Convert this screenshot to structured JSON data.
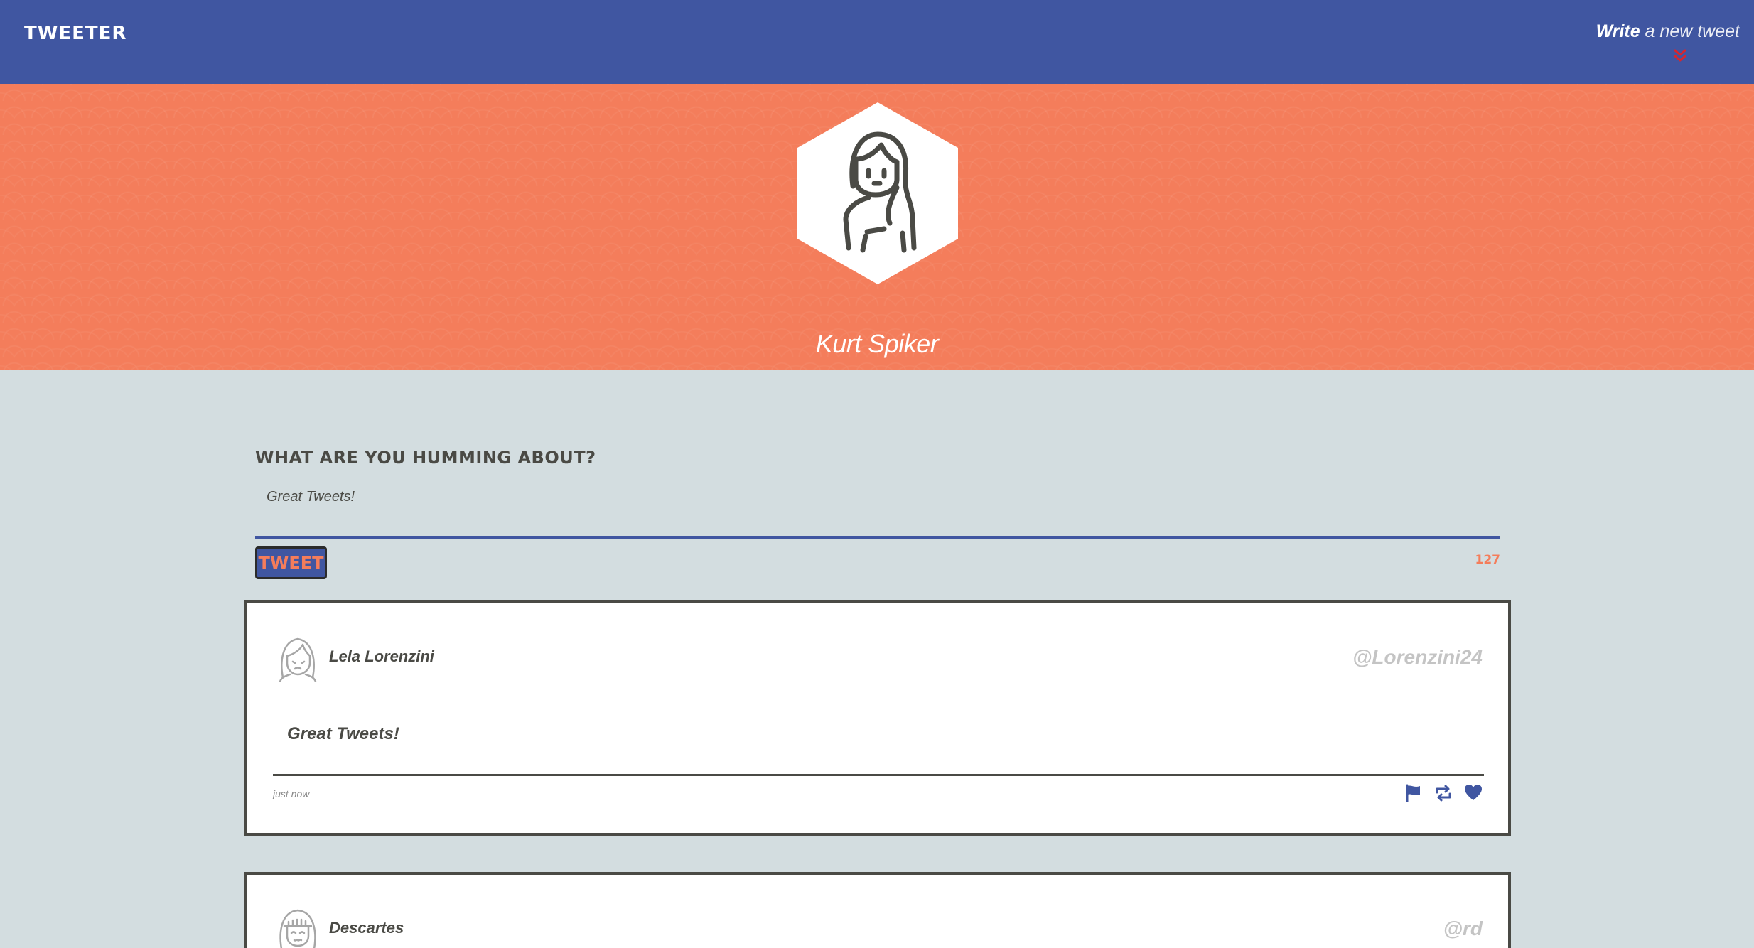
{
  "nav": {
    "brand": "TWEETER",
    "compose_toggle": {
      "strong": "Write",
      "light": "a new tweet"
    }
  },
  "profile": {
    "name": "Kurt Spiker"
  },
  "compose": {
    "heading": "What are you humming about?",
    "text": "Great Tweets!",
    "button_label": "Tweet",
    "counter": "127"
  },
  "tweets": [
    {
      "name": "Lela Lorenzini",
      "handle": "@Lorenzini24",
      "body": "Great Tweets!",
      "time": "just now",
      "actions": [
        "flag-icon",
        "retweet-icon",
        "heart-icon"
      ]
    },
    {
      "name": "Descartes",
      "handle": "@rd",
      "body": "",
      "time": "",
      "actions": []
    }
  ],
  "colors": {
    "nav": "#4056a1",
    "hero": "#f47d5b",
    "page": "#d3dde0",
    "text": "#4a4a45",
    "accent_red": "#d8252e"
  }
}
